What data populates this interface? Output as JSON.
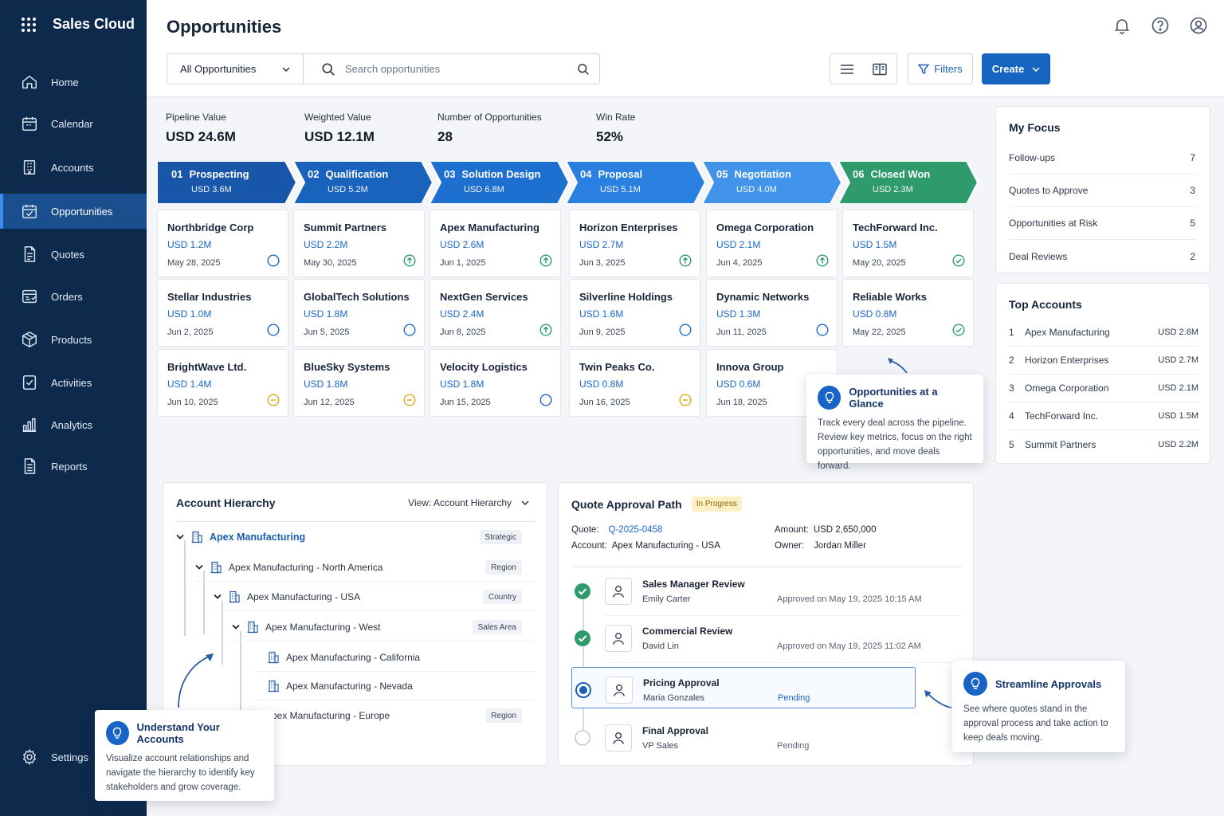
{
  "app": {
    "title": "Sales Cloud"
  },
  "sidebar": {
    "items": [
      {
        "label": "Home",
        "icon": "home-icon"
      },
      {
        "label": "Calendar",
        "icon": "calendar-icon"
      },
      {
        "label": "Accounts",
        "icon": "building-icon"
      },
      {
        "label": "Opportunities",
        "icon": "opportunity-icon",
        "active": true
      },
      {
        "label": "Quotes",
        "icon": "document-icon"
      },
      {
        "label": "Orders",
        "icon": "orders-icon"
      },
      {
        "label": "Products",
        "icon": "box-icon"
      },
      {
        "label": "Activities",
        "icon": "checklist-icon"
      },
      {
        "label": "Analytics",
        "icon": "bar-chart-icon"
      },
      {
        "label": "Reports",
        "icon": "report-icon"
      }
    ],
    "settings_label": "Settings"
  },
  "header": {
    "title": "Opportunities",
    "view_select": "All Opportunities",
    "search_placeholder": "Search opportunities",
    "filters_label": "Filters",
    "create_label": "Create"
  },
  "metrics": [
    {
      "label": "Pipeline Value",
      "value": "USD 24.6M"
    },
    {
      "label": "Weighted Value",
      "value": "USD 12.1M"
    },
    {
      "label": "Number of Opportunities",
      "value": "28"
    },
    {
      "label": "Win Rate",
      "value": "52%"
    }
  ],
  "stages": [
    {
      "num": "01",
      "name": "Prospecting",
      "amount": "USD 3.6M",
      "color": "#1756a8"
    },
    {
      "num": "02",
      "name": "Qualification",
      "amount": "USD 5.2M",
      "color": "#1a63bd"
    },
    {
      "num": "03",
      "name": "Solution Design",
      "amount": "USD 6.8M",
      "color": "#1e70d0"
    },
    {
      "num": "04",
      "name": "Proposal",
      "amount": "USD 5.1M",
      "color": "#2a80e0"
    },
    {
      "num": "05",
      "name": "Negotiation",
      "amount": "USD 4.0M",
      "color": "#4194ea"
    },
    {
      "num": "06",
      "name": "Closed Won",
      "amount": "USD 2.3M",
      "color": "#2f9a6c"
    }
  ],
  "deals": [
    [
      {
        "company": "Northbridge Corp",
        "amount": "USD 1.2M",
        "date": "May 28, 2025",
        "status": "open"
      },
      {
        "company": "Stellar Industries",
        "amount": "USD 1.0M",
        "date": "Jun 2, 2025",
        "status": "open"
      },
      {
        "company": "BrightWave Ltd.",
        "amount": "USD 1.4M",
        "date": "Jun 10, 2025",
        "status": "hold"
      }
    ],
    [
      {
        "company": "Summit Partners",
        "amount": "USD 2.2M",
        "date": "May 30, 2025",
        "status": "up"
      },
      {
        "company": "GlobalTech Solutions",
        "amount": "USD 1.8M",
        "date": "Jun 5, 2025",
        "status": "open"
      },
      {
        "company": "BlueSky Systems",
        "amount": "USD 1.8M",
        "date": "Jun 12, 2025",
        "status": "hold"
      }
    ],
    [
      {
        "company": "Apex Manufacturing",
        "amount": "USD 2.6M",
        "date": "Jun 1, 2025",
        "status": "up"
      },
      {
        "company": "NextGen Services",
        "amount": "USD 2.4M",
        "date": "Jun 8, 2025",
        "status": "up"
      },
      {
        "company": "Velocity Logistics",
        "amount": "USD 1.8M",
        "date": "Jun 15, 2025",
        "status": "open"
      }
    ],
    [
      {
        "company": "Horizon Enterprises",
        "amount": "USD 2.7M",
        "date": "Jun 3, 2025",
        "status": "up"
      },
      {
        "company": "Silverline Holdings",
        "amount": "USD 1.6M",
        "date": "Jun 9, 2025",
        "status": "open"
      },
      {
        "company": "Twin Peaks Co.",
        "amount": "USD 0.8M",
        "date": "Jun 16, 2025",
        "status": "hold"
      }
    ],
    [
      {
        "company": "Omega Corporation",
        "amount": "USD 2.1M",
        "date": "Jun 4, 2025",
        "status": "up"
      },
      {
        "company": "Dynamic Networks",
        "amount": "USD 1.3M",
        "date": "Jun 11, 2025",
        "status": "open"
      },
      {
        "company": "Innova Group",
        "amount": "USD 0.6M",
        "date": "Jun 18, 2025",
        "status": "hold"
      }
    ],
    [
      {
        "company": "TechForward Inc.",
        "amount": "USD 1.5M",
        "date": "May 20, 2025",
        "status": "won"
      },
      {
        "company": "Reliable Works",
        "amount": "USD 0.8M",
        "date": "May 22, 2025",
        "status": "won"
      }
    ]
  ],
  "my_focus": {
    "title": "My Focus",
    "items": [
      {
        "label": "Follow-ups",
        "count": "7"
      },
      {
        "label": "Quotes to Approve",
        "count": "3"
      },
      {
        "label": "Opportunities at Risk",
        "count": "5"
      },
      {
        "label": "Deal Reviews",
        "count": "2"
      }
    ]
  },
  "top_accounts": {
    "title": "Top Accounts",
    "items": [
      {
        "rank": "1",
        "name": "Apex Manufacturing",
        "amount": "USD 2.6M"
      },
      {
        "rank": "2",
        "name": "Horizon Enterprises",
        "amount": "USD 2.7M"
      },
      {
        "rank": "3",
        "name": "Omega Corporation",
        "amount": "USD 2.1M"
      },
      {
        "rank": "4",
        "name": "TechForward Inc.",
        "amount": "USD 1.5M"
      },
      {
        "rank": "5",
        "name": "Summit Partners",
        "amount": "USD 2.2M"
      }
    ]
  },
  "hierarchy": {
    "title": "Account Hierarchy",
    "view_label": "View: Account Hierarchy",
    "nodes": [
      {
        "name": "Apex Manufacturing",
        "tag": "Strategic"
      },
      {
        "name": "Apex Manufacturing - North America",
        "tag": "Region"
      },
      {
        "name": "Apex Manufacturing - USA",
        "tag": "Country"
      },
      {
        "name": "Apex Manufacturing - West",
        "tag": "Sales Area"
      },
      {
        "name": "Apex Manufacturing - California",
        "tag": ""
      },
      {
        "name": "Apex Manufacturing - Nevada",
        "tag": ""
      },
      {
        "name": "Apex Manufacturing - Europe",
        "tag": "Region"
      }
    ]
  },
  "approval": {
    "title": "Quote Approval Path",
    "status_badge": "In Progress",
    "quote_label": "Quote:",
    "quote_id": "Q-2025-0458",
    "account_label": "Account:",
    "account_value": "Apex Manufacturing - USA",
    "amount_label": "Amount:",
    "amount_value": "USD 2,650,000",
    "owner_label": "Owner:",
    "owner_value": "Jordan Miller",
    "steps": [
      {
        "name": "Sales Manager Review",
        "person": "Emily Carter",
        "status": "Approved on May 19, 2025 10:15 AM",
        "state": "done"
      },
      {
        "name": "Commercial Review",
        "person": "David Lin",
        "status": "Approved on May 19, 2025 11:02 AM",
        "state": "done"
      },
      {
        "name": "Pricing Approval",
        "person": "Maria Gonzales",
        "status": "Pending",
        "state": "current"
      },
      {
        "name": "Final Approval",
        "person": "VP Sales",
        "status": "Pending",
        "state": "todo"
      }
    ]
  },
  "tips": {
    "glance": {
      "title": "Opportunities at a Glance",
      "body": "Track every deal across the pipeline. Review key metrics, focus on the right opportunities, and move deals forward."
    },
    "accounts": {
      "title": "Understand Your Accounts",
      "body": "Visualize account relationships and navigate the hierarchy to identify key stakeholders and grow coverage."
    },
    "approvals": {
      "title": "Streamline Approvals",
      "body": "See where quotes stand in the approval process and take action to keep deals moving."
    }
  },
  "colors": {
    "sidebar": "#0d2a4d",
    "accent": "#1565c0",
    "success": "#2f9a6c",
    "warning": "#e5a416"
  }
}
